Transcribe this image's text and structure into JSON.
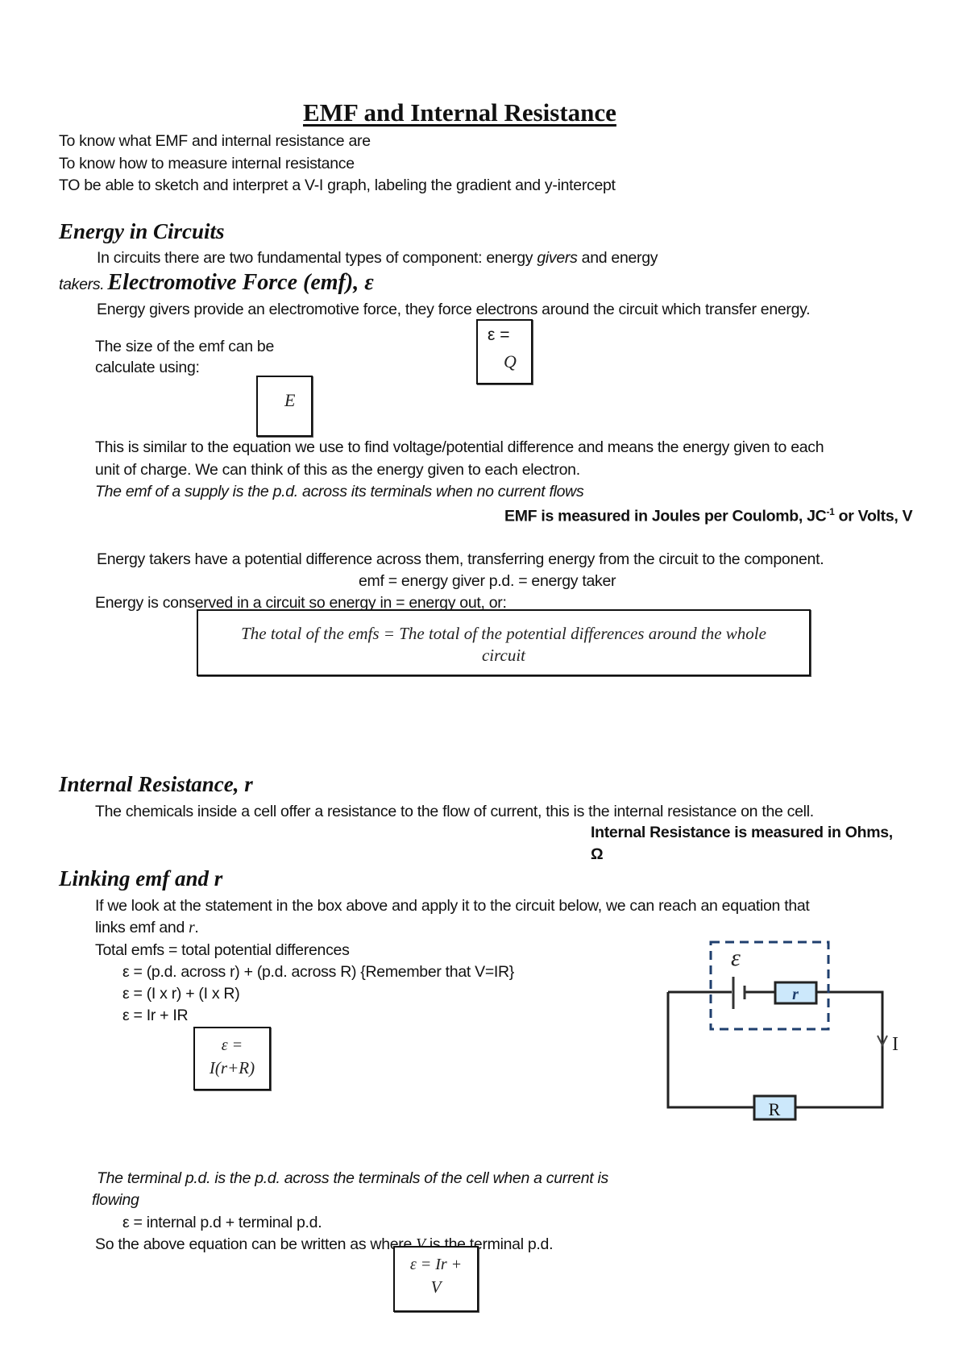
{
  "title": "EMF and Internal Resistance",
  "objectives": [
    "To know what EMF and internal resistance are",
    "To know how to measure internal resistance",
    "TO be able to sketch and interpret a V-I graph, labeling the gradient and y-intercept"
  ],
  "energy_in_circuits": {
    "heading": "Energy in Circuits",
    "intro_part1": "In circuits there are two fundamental types of component: energy ",
    "intro_givers": "givers",
    "intro_part2": " and energy",
    "intro_takers": "takers.",
    "emf_heading": "Electromotive Force (emf), ε",
    "givers_text": "Energy givers provide an electromotive force, they force electrons around the circuit which transfer energy.",
    "size_line1": "The size of the emf can be",
    "size_line2": "calculate using:",
    "eq_box_top": "ε =",
    "eq_box_bottom": "Q",
    "eq_box_E": "E",
    "similar_line1": "This is similar to the equation we use to find voltage/potential difference and means the energy given to each",
    "similar_line2": "unit of charge. We can think of this as the energy given to each electron.",
    "definition": "The emf of a supply is the p.d. across its terminals when no current flows",
    "units_pre": "EMF is measured in Joules per Coulomb, JC",
    "units_sup": "-1",
    "units_post": " or Volts, V",
    "takers_text": "Energy takers have a potential difference across them, transferring energy from the circuit to the component.",
    "emf_equals": "emf = energy giver p.d. = energy taker",
    "conserved_text": "Energy is conserved in a circuit so energy in = energy out, or:",
    "statement_line1": "The total of the emfs = The total of the potential differences around the whole",
    "statement_line2": "circuit"
  },
  "internal_resistance": {
    "heading": "Internal Resistance, r",
    "text": "The chemicals inside a cell offer a resistance to the flow of current, this is the internal resistance on the cell.",
    "units_line1": "Internal Resistance is measured in Ohms,",
    "units_line2": "Ω"
  },
  "linking": {
    "heading": "Linking emf and r",
    "line1": "If we look at the statement in the box above and apply it to the circuit below, we can reach an equation that",
    "line2_pre": "links emf and ",
    "line2_r": "r",
    "line2_post": ".",
    "total": "Total emfs = total potential differences",
    "eq1": "ε = (p.d. across r) + (p.d. across R) {Remember that V=IR}",
    "eq2": "ε = (I x r) + (I x R)",
    "eq3": "ε = Ir + IR",
    "box_line1": "ε =",
    "box_line2": "I(r+R)",
    "terminal_line1": "The terminal p.d. is the p.d. across the terminals of the cell when a current is",
    "terminal_line2": "flowing",
    "eq4": "ε = internal p.d + terminal p.d.",
    "so_pre": "So the above equation can be written as where ",
    "so_V": "V",
    "so_post": " is the terminal p.d.",
    "final_box_line1": "ε = Ir +",
    "final_box_line2": "V"
  },
  "circuit": {
    "emf_label": "ε",
    "internal_resistor_label": "r",
    "external_resistor_label": "R",
    "current_label": "I",
    "colors": {
      "wire": "#222222",
      "dashed_box": "#1f3f6e",
      "resistor_fill": "#cce8fb"
    }
  }
}
